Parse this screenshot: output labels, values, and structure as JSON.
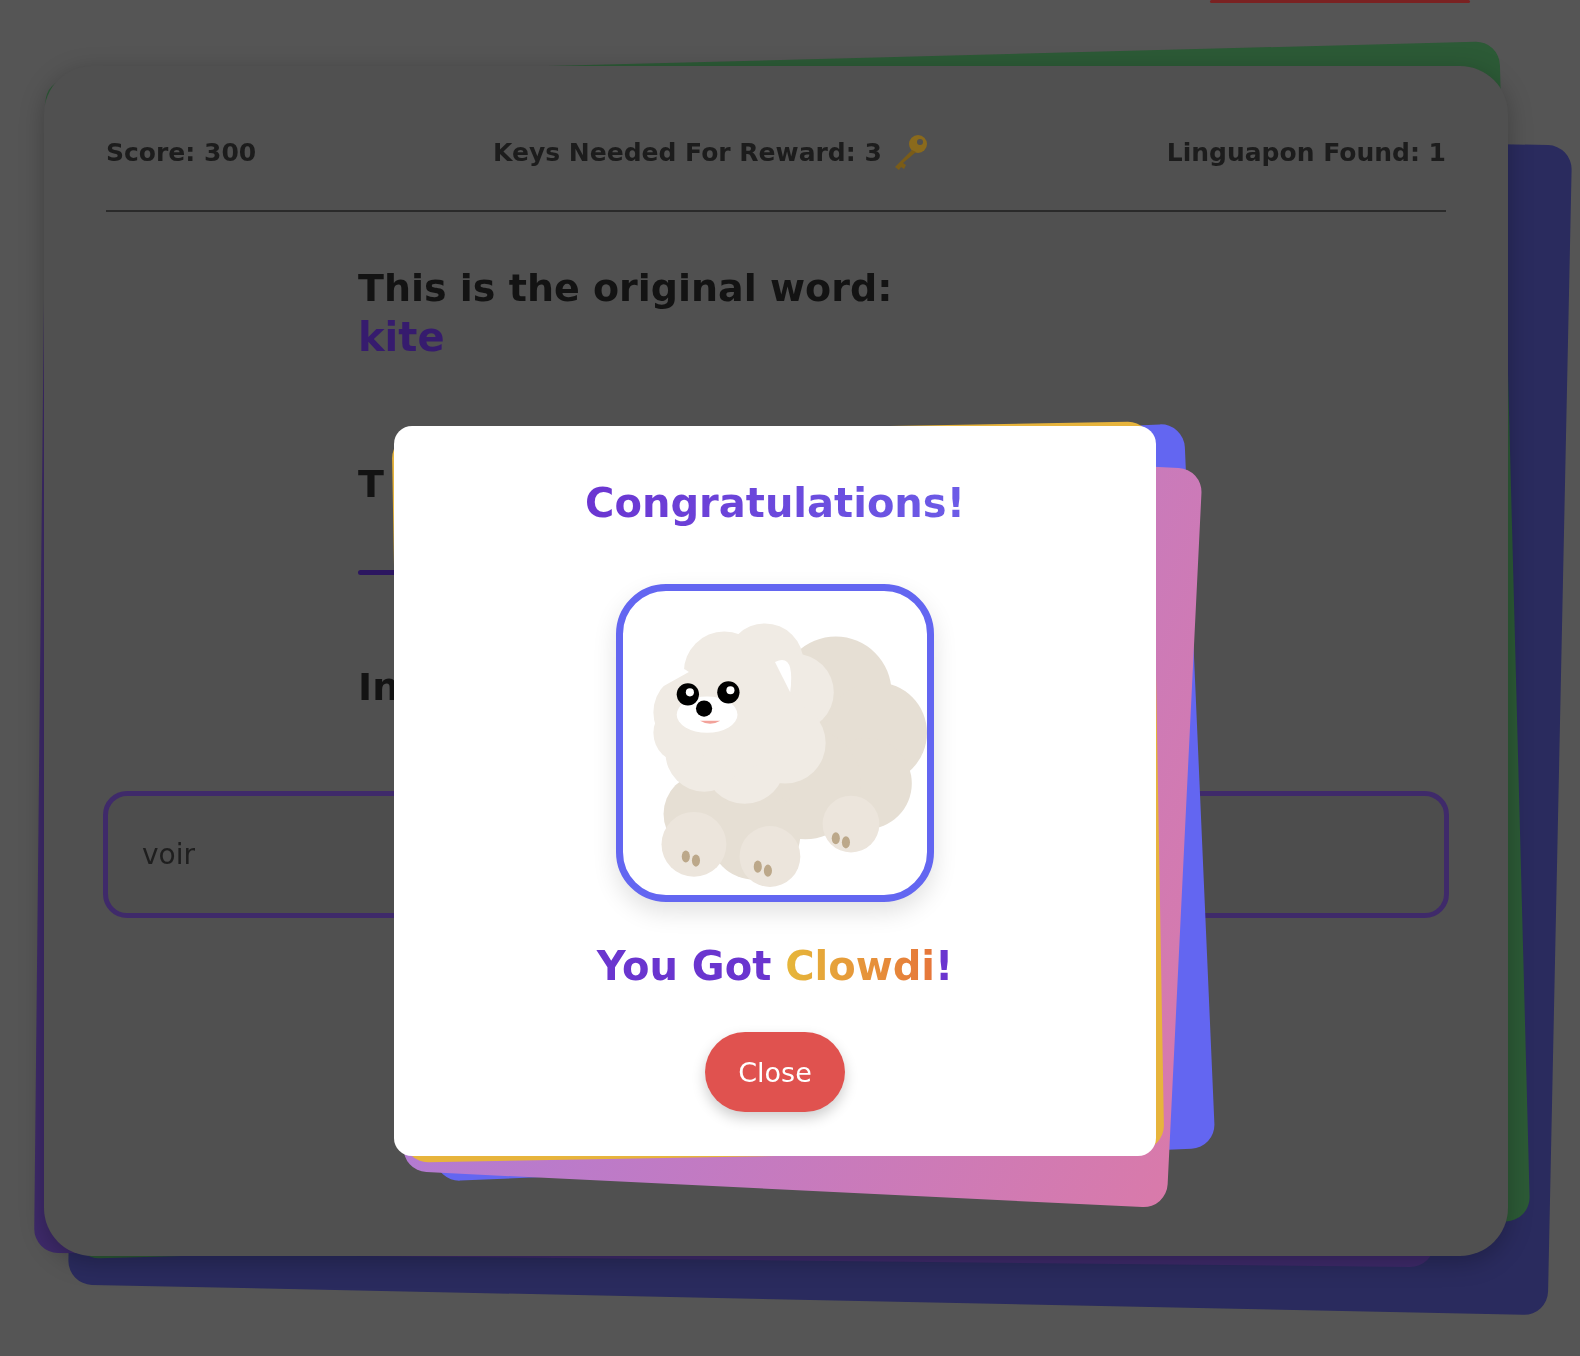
{
  "stats": [
    {
      "label": "Score: 300",
      "kind": "plain"
    },
    {
      "label": "Keys Needed For Reward: 3",
      "kind": "key"
    },
    {
      "label": "Linguapon Found: 1",
      "kind": "plain"
    }
  ],
  "prompt": {
    "heading": "This is the original word:",
    "word": "kite"
  },
  "translation": {
    "heading": "T"
  },
  "instruction": {
    "heading": "In"
  },
  "answer": {
    "value": "voir"
  },
  "modal": {
    "title": "Congratulations!",
    "message_start": "You Got ",
    "reward_name": "Clowdi",
    "message_end": "!",
    "button": "Close"
  }
}
